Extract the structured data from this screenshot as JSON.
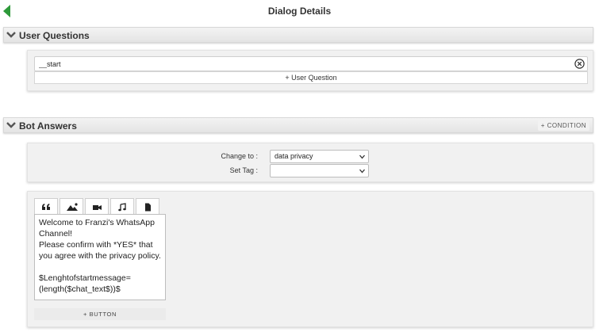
{
  "header": {
    "title": "Dialog Details"
  },
  "user_questions": {
    "title": "User Questions",
    "question_value": "__start",
    "add_label": "+ User Question"
  },
  "bot_answers": {
    "title": "Bot Answers",
    "condition_label": "+ CONDITION",
    "change_to": {
      "label": "Change to :",
      "value": "data privacy"
    },
    "set_tag": {
      "label": "Set Tag :",
      "value": ""
    },
    "tabs": [
      "quote-icon",
      "image-icon",
      "video-icon",
      "music-icon",
      "file-icon"
    ],
    "message_text": "Welcome to Franzi's WhatsApp Channel!\nPlease confirm with *YES* that you agree with the privacy policy.\n\n$Lenghtofstartmessage=(length($chat_text$))$",
    "add_button_label": "+ BUTTON"
  },
  "colors": {
    "accent": "#2e9a3a",
    "panel": "#f1f1f1"
  }
}
